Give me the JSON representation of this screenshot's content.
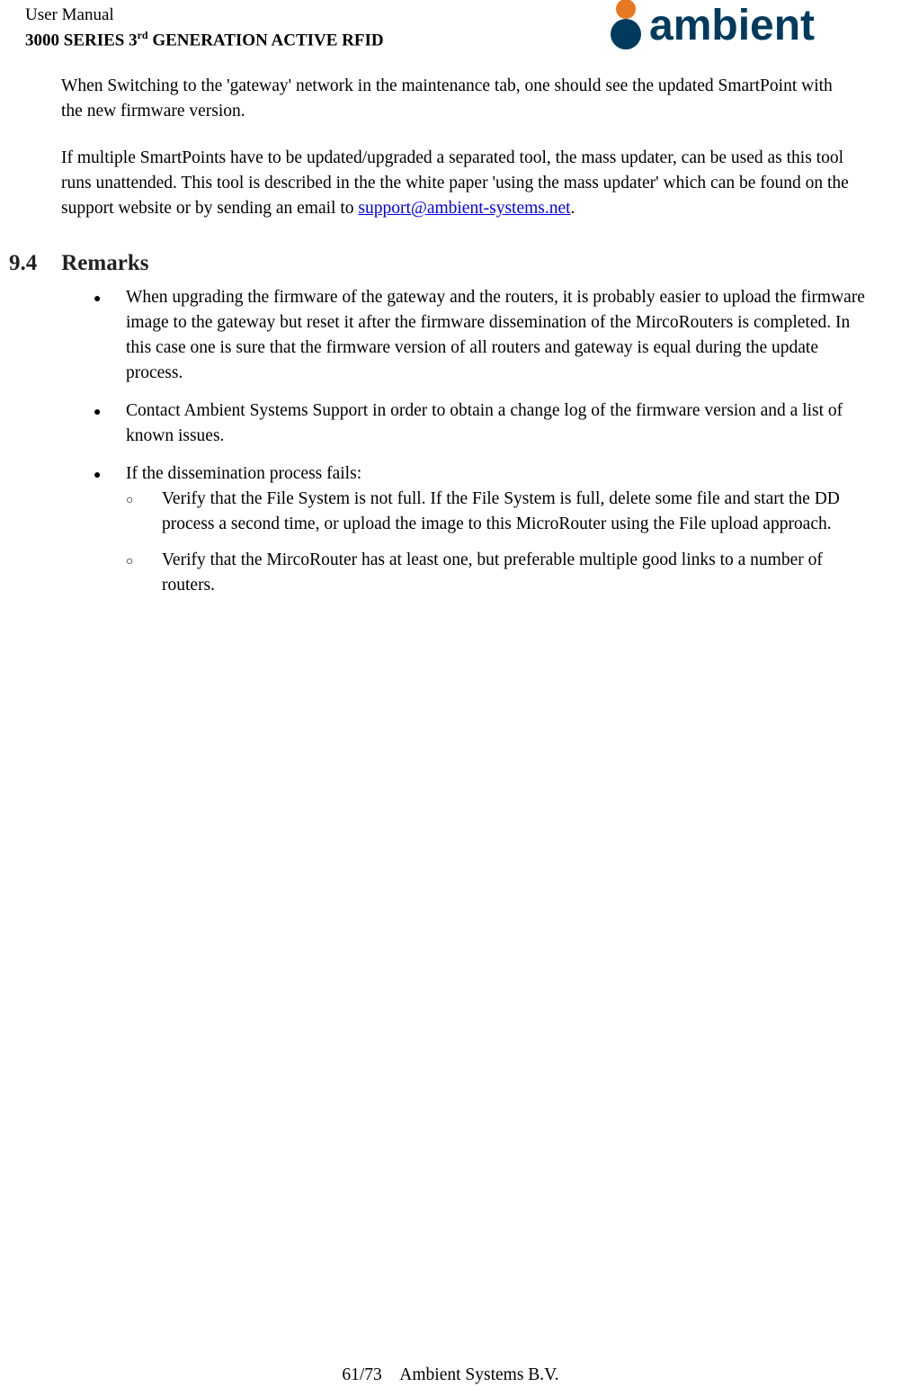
{
  "header": {
    "line1": "User Manual",
    "line2_prefix": "3000 SERIES 3",
    "line2_sup": "rd",
    "line2_suffix": " GENERATION ACTIVE RFID",
    "logo_text": "ambient"
  },
  "body": {
    "p1": "When Switching to the 'gateway' network in the maintenance tab, one should see the updated SmartPoint with the new firmware version.",
    "p2_a": "If multiple SmartPoints have to be updated/upgraded a separated tool, the mass updater, can be used as this tool runs unattended. This tool is described in the the white paper 'using the mass updater' which can be found on the support website or by sending an email to ",
    "p2_link": "support@ambient-systems.net",
    "p2_b": "."
  },
  "section": {
    "num": "9.4",
    "title": "Remarks"
  },
  "bullets": [
    "When upgrading the firmware of the gateway and the routers, it is probably easier to upload the firmware image to the gateway but reset it after the firmware dissemination of the MircoRouters is completed. In this case one is sure that the firmware version of all routers and gateway is equal during the update process.",
    "Contact Ambient Systems Support in order to obtain a change log of the firmware version and a list of known issues.",
    "If the dissemination process fails:"
  ],
  "sub_bullets": [
    "Verify that the File System is not full. If the File System is full, delete some file and start the DD process a second time, or upload the image to this MicroRouter using the File upload approach.",
    "Verify that the MircoRouter has at least one, but preferable multiple good links to a number of routers."
  ],
  "footer": {
    "page": "61/73",
    "company": "Ambient Systems B.V."
  }
}
